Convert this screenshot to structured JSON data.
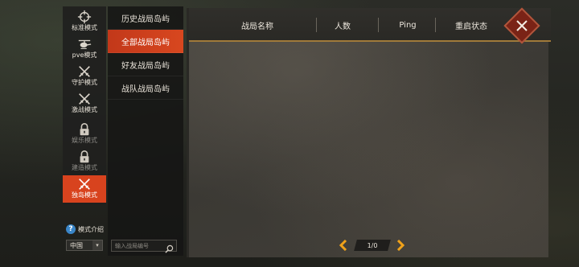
{
  "modes": [
    {
      "label": "标准模式",
      "icon": "crosshair-icon",
      "locked": false,
      "active": false
    },
    {
      "label": "pve模式",
      "icon": "helicopter-icon",
      "locked": false,
      "active": false
    },
    {
      "label": "守护模式",
      "icon": "crossed-swords-icon",
      "locked": false,
      "active": false
    },
    {
      "label": "激战模式",
      "icon": "crossed-swords-icon",
      "locked": false,
      "active": false
    },
    {
      "label": "娱乐模式",
      "icon": "lock-icon",
      "locked": true,
      "active": false
    },
    {
      "label": "建造模式",
      "icon": "lock-icon",
      "locked": true,
      "active": false
    },
    {
      "label": "独岛模式",
      "icon": "crossed-swords-icon",
      "locked": false,
      "active": true
    }
  ],
  "submenu": [
    {
      "label": "历史战局岛屿",
      "active": false
    },
    {
      "label": "全部战局岛屿",
      "active": true
    },
    {
      "label": "好友战局岛屿",
      "active": false
    },
    {
      "label": "战队战局岛屿",
      "active": false
    }
  ],
  "table": {
    "columns": [
      "战局名称",
      "人数",
      "Ping",
      "重启状态"
    ]
  },
  "mode_intro": {
    "label": "模式介绍"
  },
  "region": {
    "value": "中国"
  },
  "search": {
    "placeholder": "输入战局编号"
  },
  "pagination": {
    "text": "1/0"
  },
  "colors": {
    "accent": "#d8431e",
    "arrow": "#f0a21a",
    "header_rule": "#a07a3a"
  }
}
